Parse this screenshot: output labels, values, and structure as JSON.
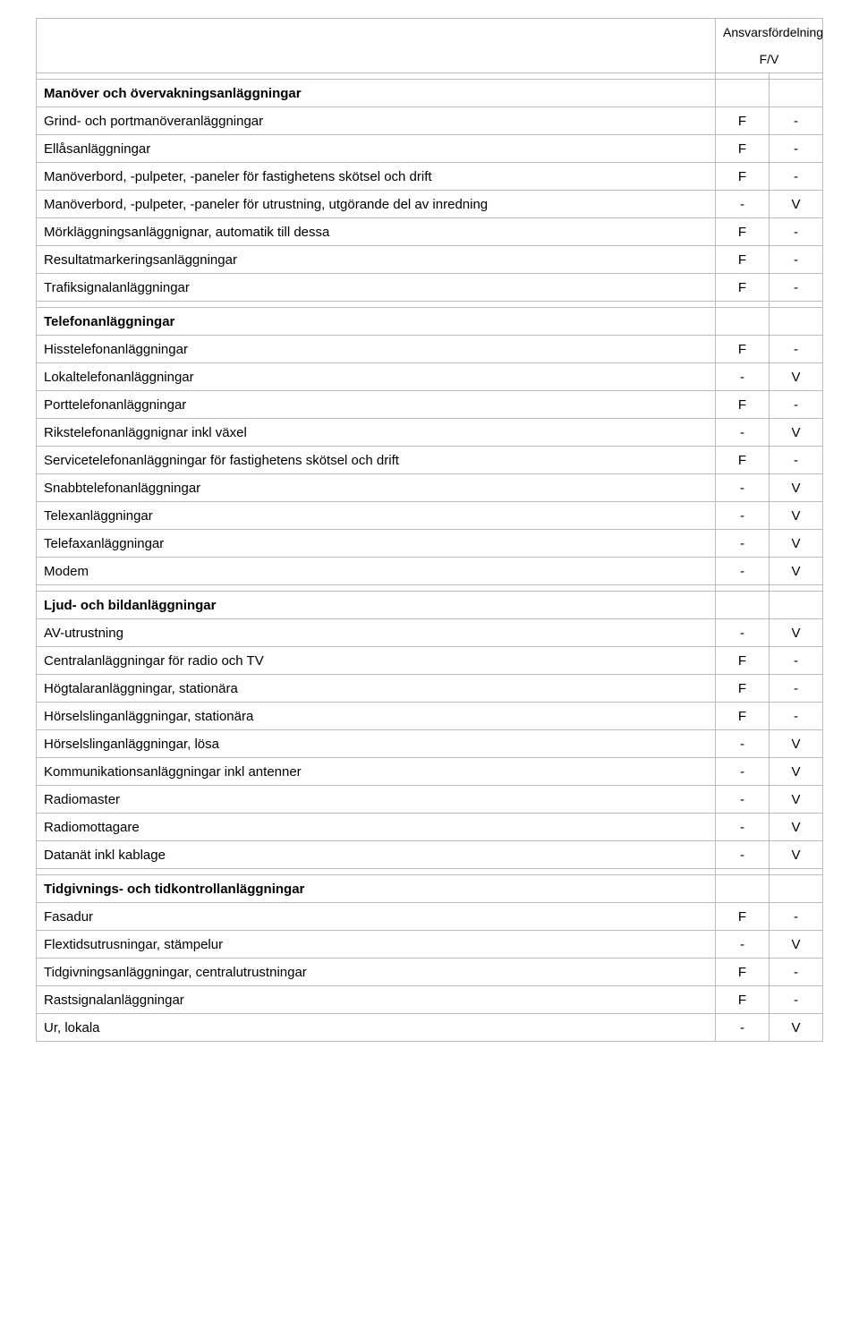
{
  "header": {
    "title": "Ansvarsfördelning",
    "subtitle": "F/V"
  },
  "sections": [
    {
      "heading": "Manöver och övervakningsanläggningar",
      "rows": [
        {
          "label": "Grind- och portmanöveranläggningar",
          "f": "F",
          "v": "-"
        },
        {
          "label": "Ellåsanläggningar",
          "f": "F",
          "v": "-"
        },
        {
          "label": "Manöverbord, -pulpeter, -paneler för fastighetens skötsel och drift",
          "f": "F",
          "v": "-"
        },
        {
          "label": "Manöverbord, -pulpeter, -paneler för utrustning, utgörande del av inredning",
          "f": "-",
          "v": "V"
        },
        {
          "label": "Mörkläggningsanläggnignar, automatik till dessa",
          "f": "F",
          "v": "-"
        },
        {
          "label": "Resultatmarkeringsanläggningar",
          "f": "F",
          "v": "-"
        },
        {
          "label": "Trafiksignalanläggningar",
          "f": "F",
          "v": "-"
        }
      ]
    },
    {
      "heading": "Telefonanläggningar",
      "rows": [
        {
          "label": "Hisstelefonanläggningar",
          "f": "F",
          "v": "-"
        },
        {
          "label": "Lokaltelefonanläggningar",
          "f": "-",
          "v": "V"
        },
        {
          "label": "Porttelefonanläggningar",
          "f": "F",
          "v": "-"
        },
        {
          "label": "Rikstelefonanläggnignar inkl växel",
          "f": "-",
          "v": "V"
        },
        {
          "label": "Servicetelefonanläggningar för fastighetens skötsel och drift",
          "f": "F",
          "v": "-"
        },
        {
          "label": "Snabbtelefonanläggningar",
          "f": "-",
          "v": "V"
        },
        {
          "label": "Telexanläggningar",
          "f": "-",
          "v": "V"
        },
        {
          "label": "Telefaxanläggningar",
          "f": "-",
          "v": "V"
        },
        {
          "label": "Modem",
          "f": "-",
          "v": "V"
        }
      ]
    },
    {
      "heading": "Ljud- och bildanläggningar",
      "rows": [
        {
          "label": "AV-utrustning",
          "f": "-",
          "v": "V"
        },
        {
          "label": "Centralanläggningar för radio och TV",
          "f": "F",
          "v": "-"
        },
        {
          "label": "Högtalaranläggningar, stationära",
          "f": "F",
          "v": "-"
        },
        {
          "label": "Hörselslinganläggningar, stationära",
          "f": "F",
          "v": "-"
        },
        {
          "label": "Hörselslinganläggningar, lösa",
          "f": "-",
          "v": "V"
        },
        {
          "label": "Kommunikationsanläggningar inkl antenner",
          "f": "-",
          "v": "V"
        },
        {
          "label": "Radiomaster",
          "f": "-",
          "v": "V"
        },
        {
          "label": "Radiomottagare",
          "f": "-",
          "v": "V"
        },
        {
          "label": "Datanät inkl kablage",
          "f": "-",
          "v": "V"
        }
      ]
    },
    {
      "heading": "Tidgivnings- och tidkontrollanläggningar",
      "rows": [
        {
          "label": "Fasadur",
          "f": "F",
          "v": "-"
        },
        {
          "label": "Flextidsutrusningar, stämpelur",
          "f": "-",
          "v": "V"
        },
        {
          "label": "Tidgivningsanläggningar, centralutrustningar",
          "f": "F",
          "v": "-"
        },
        {
          "label": "Rastsignalanläggningar",
          "f": "F",
          "v": "-"
        },
        {
          "label": "Ur, lokala",
          "f": "-",
          "v": "V"
        }
      ]
    }
  ]
}
